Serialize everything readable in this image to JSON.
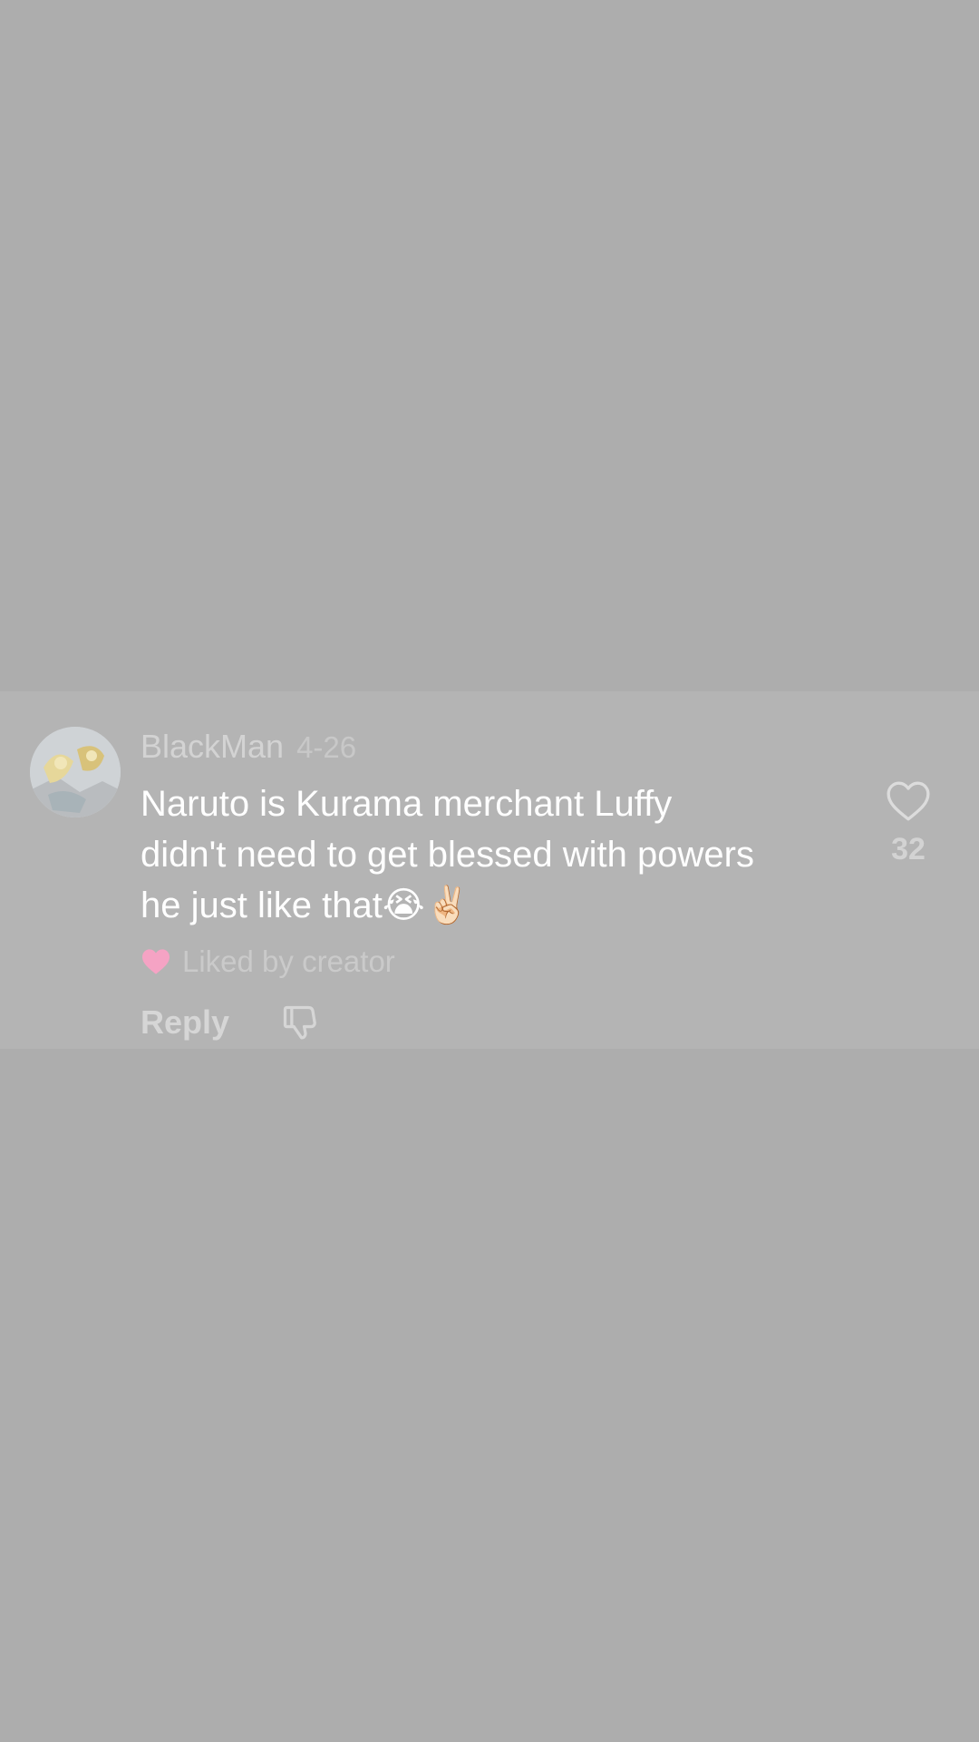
{
  "comment": {
    "username": "BlackMan",
    "date": "4-26",
    "text": "Naruto is Kurama merchant Luffy didn't need to get blessed with powers he just like that😭✌🏻",
    "liked_by_creator": "Liked by creator",
    "reply_label": "Reply",
    "like_count": "32"
  },
  "icons": {
    "like": "heart-outline-icon",
    "liked_by_creator": "heart-filled-icon",
    "dislike": "thumbs-down-icon"
  },
  "colors": {
    "background": "#adadad",
    "card": "#b4b4b4",
    "liked_heart": "#f5a3c4"
  }
}
